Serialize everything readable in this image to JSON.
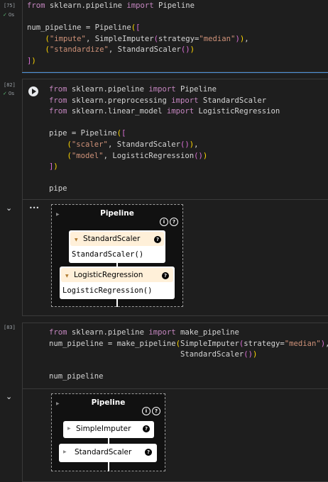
{
  "cells": [
    {
      "exec_count": "[75]",
      "status": "0s",
      "code_lines": [
        "from sklearn.pipeline import Pipeline",
        "",
        "num_pipeline = Pipeline([",
        "    (\"impute\", SimpleImputer(strategy=\"median\")),",
        "    (\"standardize\", StandardScaler())",
        "])"
      ]
    },
    {
      "exec_count": "[82]",
      "status": "0s",
      "code_lines": [
        "from sklearn.pipeline import Pipeline",
        "from sklearn.preprocessing import StandardScaler",
        "from sklearn.linear_model import LogisticRegression",
        "",
        "pipe = Pipeline([",
        "    (\"scaler\", StandardScaler()),",
        "    (\"model\", LogisticRegression())",
        "])",
        "",
        "pipe"
      ],
      "output": {
        "title": "Pipeline",
        "info_icon": "i",
        "help_icon": "?",
        "steps": [
          {
            "name": "StandardScaler",
            "repr": "StandardScaler()"
          },
          {
            "name": "LogisticRegression",
            "repr": "LogisticRegression()"
          }
        ]
      }
    },
    {
      "exec_count": "[83]",
      "code_lines": [
        "from sklearn.pipeline import make_pipeline",
        "num_pipeline = make_pipeline(SimpleImputer(strategy=\"median\"),",
        "                             StandardScaler())",
        "",
        "num_pipeline"
      ],
      "output": {
        "title": "Pipeline",
        "info_icon": "i",
        "help_icon": "?",
        "steps": [
          {
            "name": "SimpleImputer"
          },
          {
            "name": "StandardScaler"
          }
        ]
      }
    }
  ],
  "ellipsis": "•••",
  "colors": {
    "keyword": "#c586c0",
    "string": "#ce9178",
    "bracket": "#ffd700",
    "step_header": "#fff0d9"
  }
}
